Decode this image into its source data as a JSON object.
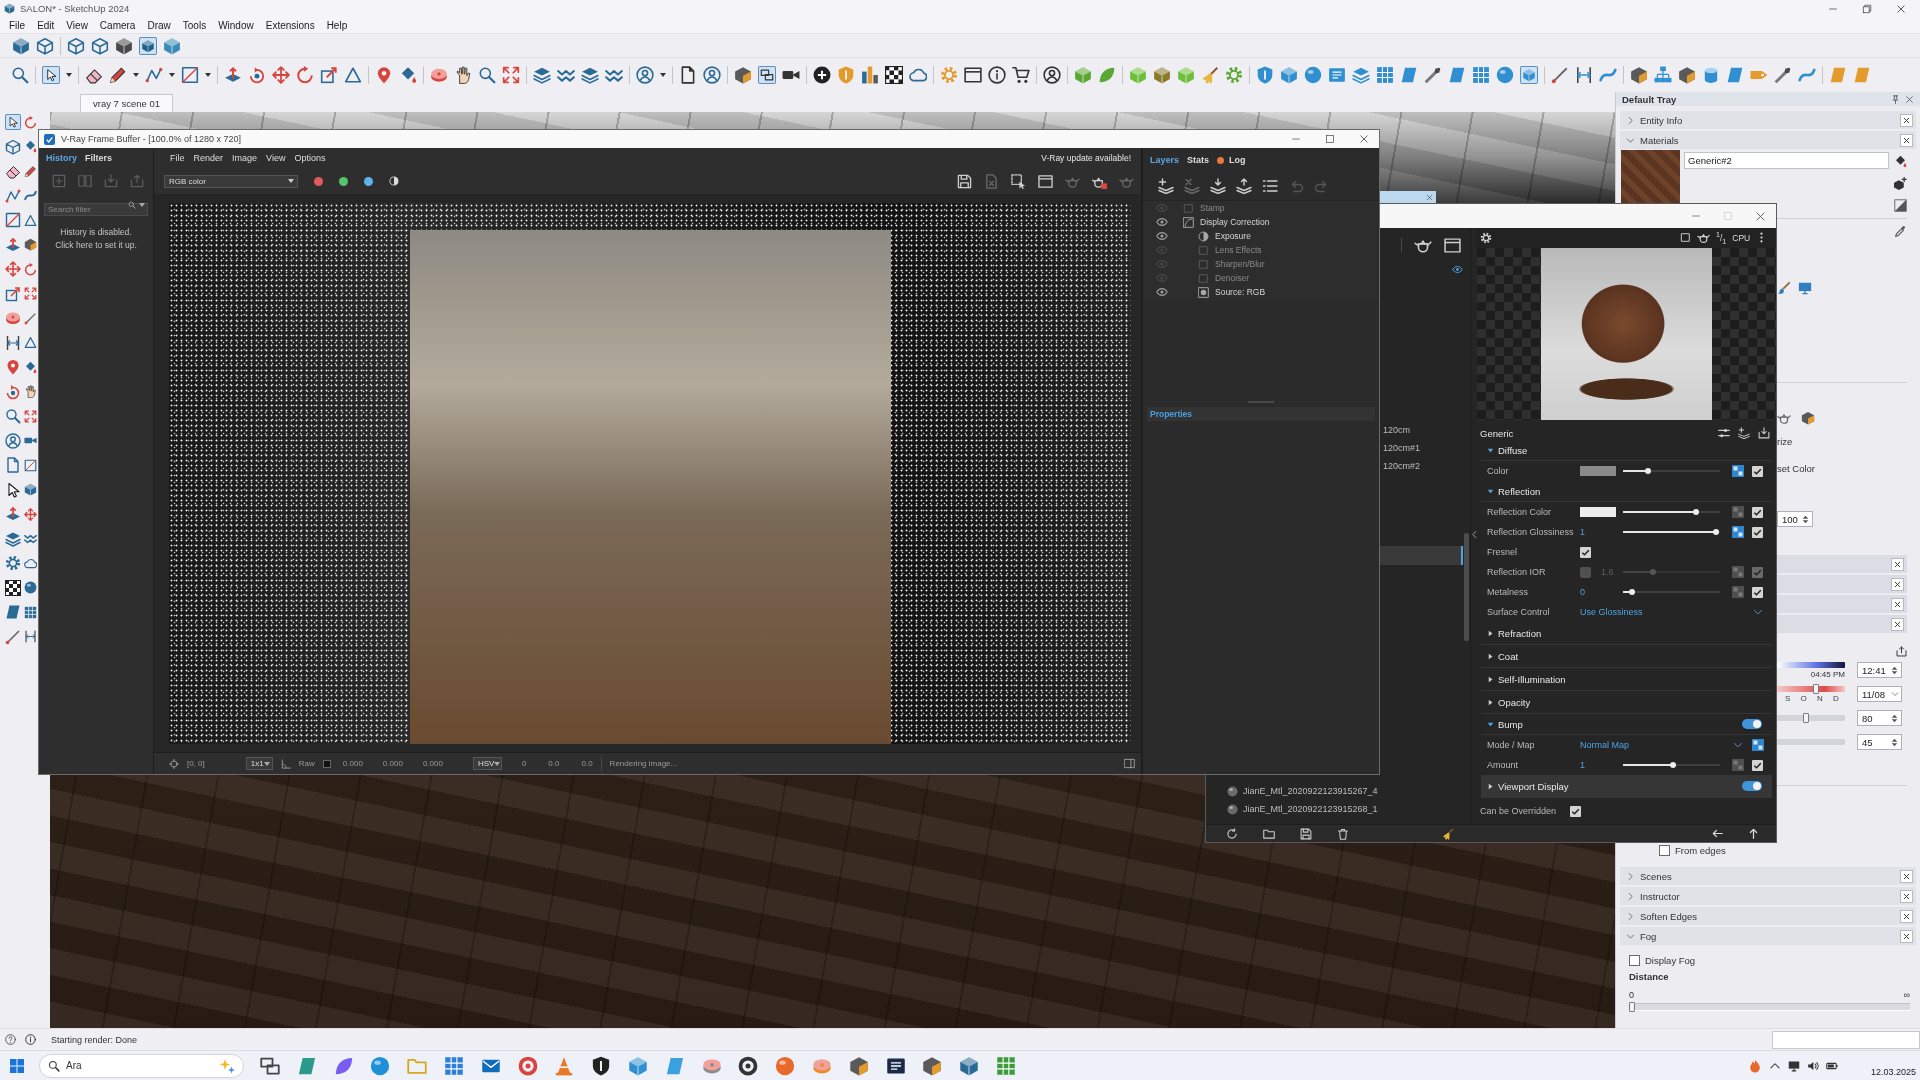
{
  "window": {
    "title": "SALON* - SketchUp 2024"
  },
  "menu": [
    "File",
    "Edit",
    "View",
    "Camera",
    "Draw",
    "Tools",
    "Window",
    "Extensions",
    "Help"
  ],
  "toolbars": {
    "row_1": [
      {
        "selected": false
      },
      {
        "selected": false
      },
      {
        "selected": false
      },
      {
        "selected": false
      },
      {
        "selected": false
      },
      {
        "selected": true
      },
      {
        "selected": false
      }
    ],
    "row_2": [
      {
        "selected": false
      },
      {
        "selected": true
      },
      {
        "selected": false
      },
      {
        "selected": false
      },
      {
        "selected": false
      },
      {
        "selected": false
      },
      {
        "selected": false
      },
      {
        "selected": false
      },
      {
        "selected": false
      },
      {
        "selected": false
      },
      {
        "selected": false
      },
      {
        "selected": false
      },
      {
        "selected": false
      },
      {
        "selected": false
      },
      {
        "selected": false
      },
      {
        "selected": false
      },
      {
        "selected": false
      },
      {
        "selected": false
      },
      {
        "selected": false
      },
      {
        "selected": false
      },
      {
        "selected": false
      },
      {
        "selected": false
      },
      {
        "selected": false
      },
      {
        "selected": false
      },
      {
        "selected": false
      },
      {
        "selected": false
      },
      {
        "selected": true
      },
      {
        "selected": false
      },
      {
        "selected": false
      },
      {
        "selected": false
      },
      {
        "selected": false
      },
      {
        "selected": false
      },
      {
        "selected": false
      },
      {
        "selected": false
      },
      {
        "selected": false
      },
      {
        "selected": false
      },
      {
        "selected": false
      },
      {
        "selected": false
      },
      {
        "selected": false
      },
      {
        "selected": false
      },
      {
        "selected": false
      },
      {
        "selected": false
      },
      {
        "selected": false
      },
      {
        "selected": false
      },
      {
        "selected": false
      },
      {
        "selected": false
      },
      {
        "selected": false
      },
      {
        "selected": false
      },
      {
        "selected": false
      },
      {
        "selected": false
      },
      {
        "selected": false
      },
      {
        "selected": false
      },
      {
        "selected": false
      },
      {
        "selected": false
      },
      {
        "selected": false
      },
      {
        "selected": false
      },
      {
        "selected": true
      },
      {
        "selected": false
      },
      {
        "selected": false
      },
      {
        "selected": false
      },
      {
        "selected": false
      },
      {
        "selected": false
      },
      {
        "selected": false
      },
      {
        "selected": false
      },
      {
        "selected": false
      },
      {
        "selected": false
      },
      {
        "selected": false
      },
      {
        "selected": false
      },
      {
        "selected": false
      },
      {
        "selected": false
      }
    ],
    "left": [
      {
        "selected": true
      },
      {
        "selected": false
      },
      {
        "selected": false
      },
      {
        "selected": false
      },
      {
        "selected": false
      },
      {
        "selected": false
      },
      {
        "selected": false
      },
      {
        "selected": false
      },
      {
        "selected": false
      },
      {
        "selected": false
      },
      {
        "selected": false
      },
      {
        "selected": false
      },
      {
        "selected": false
      },
      {
        "selected": false
      },
      {
        "selected": false
      },
      {
        "selected": false
      },
      {
        "selected": false
      },
      {
        "selected": false
      },
      {
        "selected": false
      },
      {
        "selected": false
      },
      {
        "selected": false
      },
      {
        "selected": false
      },
      {
        "selected": false
      },
      {
        "selected": false
      },
      {
        "selected": false
      },
      {
        "selected": false
      },
      {
        "selected": false
      },
      {
        "selected": false
      },
      {
        "selected": false
      },
      {
        "selected": false
      },
      {
        "selected": false
      },
      {
        "selected": false
      },
      {
        "selected": false
      },
      {
        "selected": false
      },
      {
        "selected": false
      },
      {
        "selected": false
      },
      {
        "selected": false
      },
      {
        "selected": false
      },
      {
        "selected": false
      },
      {
        "selected": false
      },
      {
        "selected": false
      },
      {
        "selected": false
      },
      {
        "selected": false
      },
      {
        "selected": false
      }
    ]
  },
  "scene_tabs": [
    {
      "label": "vray 7 scene 01",
      "selected": true
    }
  ],
  "frame_buffer": {
    "title": "V-Ray Frame Buffer - [100.0% of 1280 x 720]",
    "side_tabs": [
      {
        "label": "History",
        "selected": true
      },
      {
        "label": "Filters",
        "selected": false
      }
    ],
    "search": {
      "placeholder": "Search filter"
    },
    "history_note": [
      "History is disabled.",
      "Click here to set it up."
    ],
    "menu": [
      "File",
      "Render",
      "Image",
      "View",
      "Options"
    ],
    "notice": "V-Ray update available!",
    "channel": "RGB color",
    "channel_buttons": [
      {
        "color": "#e25b5b"
      },
      {
        "color": "#55c46b"
      },
      {
        "color": "#5cb3ea"
      }
    ],
    "panel_tabs": [
      {
        "label": "Layers",
        "selected": true,
        "alert": false
      },
      {
        "label": "Stats",
        "selected": false,
        "alert": false
      },
      {
        "label": "Log",
        "selected": false,
        "alert": true
      }
    ],
    "layers": [
      {
        "label": "Stamp",
        "enabled": false
      },
      {
        "label": "Display Correction",
        "enabled": true,
        "children": [
          {
            "label": "Exposure",
            "enabled": true
          },
          {
            "label": "Lens Effects",
            "enabled": false
          },
          {
            "label": "Sharpen/Blur",
            "enabled": false
          },
          {
            "label": "Denoiser",
            "enabled": false
          },
          {
            "label": "Source: RGB",
            "enabled": true
          }
        ]
      }
    ],
    "properties": "Properties",
    "status": {
      "coords": "[0, 0]",
      "zoom": "1x1",
      "mode": "Raw",
      "rgb": [
        "0.000",
        "0.000",
        "0.000"
      ],
      "space": "HSV",
      "hsv": [
        "0",
        "0.0",
        "0.0"
      ],
      "message": "Rendering image..."
    }
  },
  "asset_editor": {
    "list_items": [
      "120cm",
      "120cm#1",
      "120cm#2"
    ],
    "materials": [
      "JianE_Mtl_2020922123915267_4",
      "JianE_Mtl_2020922123915268_1"
    ],
    "preview": {
      "ratio": "$^{1}$/$_{1}$",
      "engine": "CPU"
    },
    "title": "Generic",
    "sections": [
      {
        "label": "Diffuse",
        "expanded": true,
        "selected": false,
        "rows": [
          {
            "kind": "color",
            "label": "Color",
            "color": "#8a8a8a",
            "level": 0.24,
            "mapped": true,
            "checked": true,
            "disabled": false
          }
        ]
      },
      {
        "label": "Reflection",
        "expanded": true,
        "selected": false,
        "rows": [
          {
            "kind": "color",
            "label": "Reflection Color",
            "color": "#ececec",
            "level": 0.77,
            "mapped": false,
            "checked": true,
            "disabled": false
          },
          {
            "kind": "value",
            "label": "Reflection Glossiness",
            "value": "1",
            "level": 0.99,
            "mapped": true,
            "checked": true,
            "disabled": false
          },
          {
            "kind": "check",
            "label": "Fresnel",
            "checked": true,
            "disabled": false
          },
          {
            "kind": "value",
            "label": "Reflection IOR",
            "value": "1.6",
            "level": 0.3,
            "mapped": false,
            "checked": true,
            "disabled": true,
            "linked": false
          },
          {
            "kind": "value",
            "label": "Metalness",
            "value": "0",
            "level": 0.07,
            "mapped": false,
            "checked": true,
            "disabled": false
          },
          {
            "kind": "select",
            "label": "Surface Control",
            "value": "Use Glossiness",
            "disabled": false
          }
        ]
      },
      {
        "label": "Refraction",
        "expanded": false,
        "selected": false
      },
      {
        "label": "Coat",
        "expanded": false,
        "selected": false
      },
      {
        "label": "Self-Illumination",
        "expanded": false,
        "selected": false
      },
      {
        "label": "Opacity",
        "expanded": false,
        "selected": false
      },
      {
        "label": "Bump",
        "expanded": true,
        "selected": false,
        "on": true,
        "rows": [
          {
            "kind": "select",
            "label": "Mode / Map",
            "value": "Normal Map",
            "mapped": true,
            "disabled": false
          },
          {
            "kind": "value",
            "label": "Amount",
            "value": "1",
            "level": 0.52,
            "mapped": false,
            "checked": true,
            "disabled": false
          }
        ]
      },
      {
        "label": "Viewport Display",
        "expanded": false,
        "selected": true,
        "on": true
      }
    ],
    "override": {
      "label": "Can be Overridden",
      "checked": true
    }
  },
  "tray": {
    "title": "Default Tray",
    "top_panels": [
      {
        "label": "Entity Info",
        "expanded": false
      },
      {
        "label": "Materials",
        "expanded": true
      }
    ],
    "material_name": "Generic#2",
    "fragments": [
      "rize",
      "set Color"
    ],
    "spin_value": "100",
    "time_controls": {
      "time_caption": "04:45 PM",
      "time": "12:41",
      "months": "S O N D",
      "date": "11/08",
      "date_slider": {
        "level": 0.58
      },
      "light": "80",
      "light_slider": {
        "level": 0.42
      },
      "dark": "45"
    },
    "from_edges": {
      "label": "From edges",
      "checked": false
    },
    "bottom_panels": [
      {
        "label": "Scenes",
        "expanded": false
      },
      {
        "label": "Instructor",
        "expanded": false
      },
      {
        "label": "Soften Edges",
        "expanded": false
      },
      {
        "label": "Fog",
        "expanded": true
      }
    ],
    "fog": {
      "display": {
        "label": "Display Fog",
        "checked": false
      },
      "distance": "Distance",
      "start": "0",
      "end": "∞",
      "slider": {
        "level": 0
      }
    }
  },
  "status_bar": {
    "message": "Starting render: Done"
  },
  "taskbar": {
    "search": {
      "placeholder": "Ara"
    },
    "date": "12.03.2025"
  }
}
